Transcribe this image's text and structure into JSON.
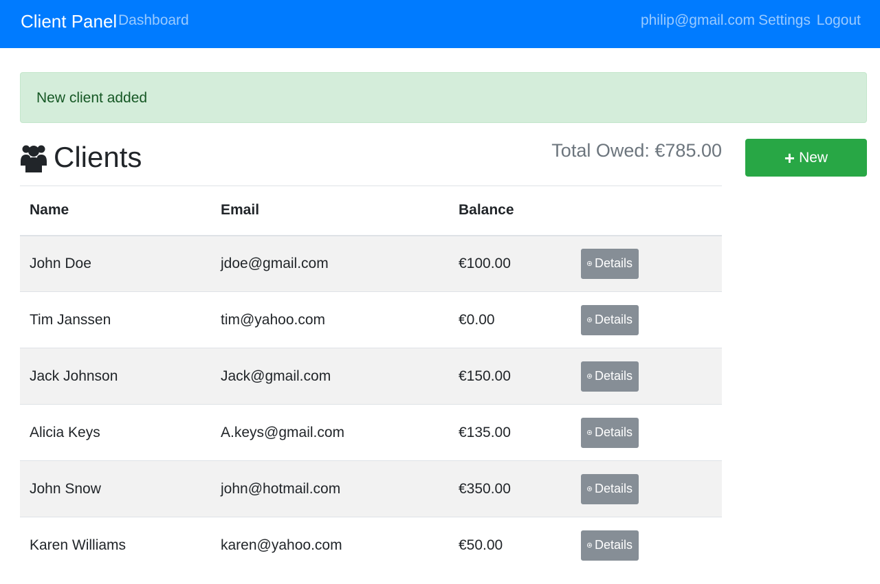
{
  "navbar": {
    "brand": "Client Panel",
    "links": {
      "dashboard": "Dashboard",
      "email": "philip@gmail.com",
      "settings": "Settings",
      "logout": "Logout"
    },
    "bg_color": "#007bff"
  },
  "alert": {
    "message": "New client added",
    "type": "success"
  },
  "page": {
    "title": "Clients",
    "title_icon": "users-icon",
    "total_label": "Total Owed:",
    "total_value": "€785.00",
    "new_button": {
      "icon": "plus-icon",
      "label": "New"
    }
  },
  "table": {
    "headers": {
      "name": "Name",
      "email": "Email",
      "balance": "Balance"
    },
    "details_label": "Details",
    "details_icon": "arrow-circle-right-icon",
    "rows": [
      {
        "name": "John Doe",
        "email": "jdoe@gmail.com",
        "balance": "€100.00"
      },
      {
        "name": "Tim Janssen",
        "email": "tim@yahoo.com",
        "balance": "€0.00"
      },
      {
        "name": "Jack Johnson",
        "email": "Jack@gmail.com",
        "balance": "€150.00"
      },
      {
        "name": "Alicia Keys",
        "email": "A.keys@gmail.com",
        "balance": "€135.00"
      },
      {
        "name": "John Snow",
        "email": "john@hotmail.com",
        "balance": "€350.00"
      },
      {
        "name": "Karen Williams",
        "email": "karen@yahoo.com",
        "balance": "€50.00"
      }
    ]
  }
}
